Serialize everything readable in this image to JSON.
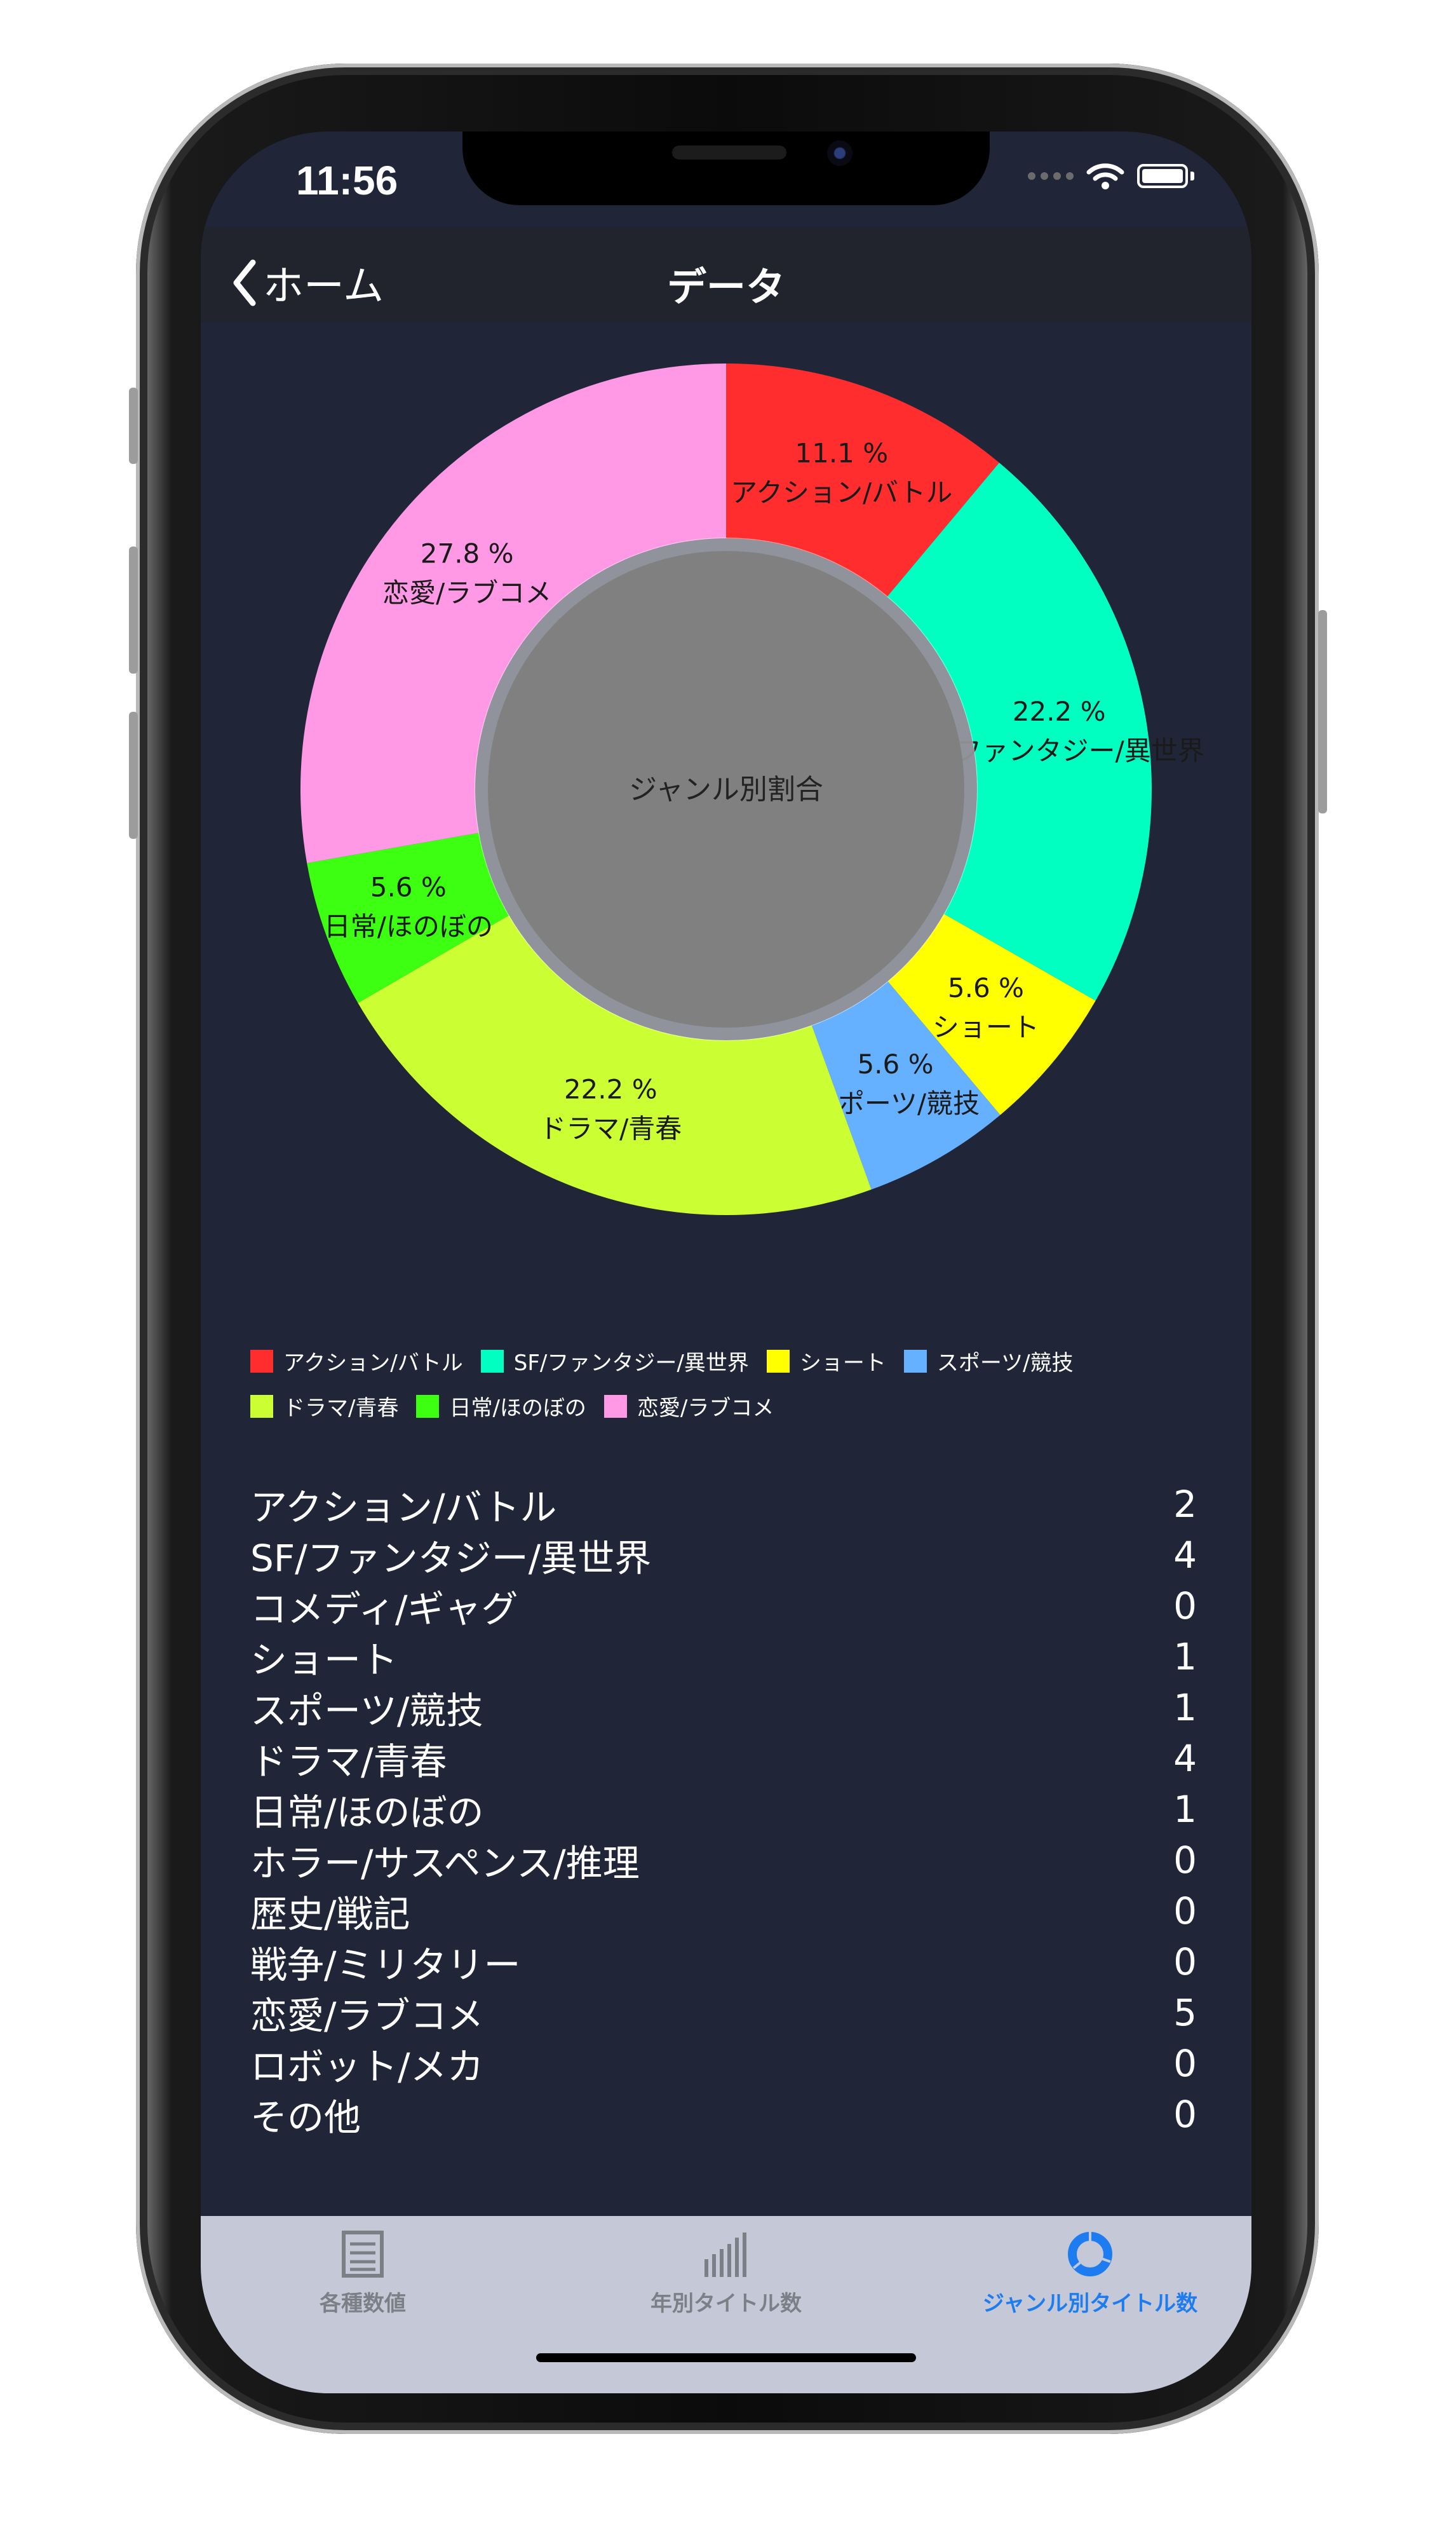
{
  "status": {
    "time": "11:56"
  },
  "nav": {
    "back_label": "ホーム",
    "title": "データ"
  },
  "chart_data": {
    "type": "pie",
    "title": "ジャンル別割合",
    "slices": [
      {
        "label": "アクション/バトル",
        "value": 11.1,
        "pct_label": "11.1 %",
        "color": "#ff2d2d"
      },
      {
        "label": "SF/ファンタジー/異世界",
        "value": 22.2,
        "pct_label": "22.2 %",
        "color": "#00ffc0"
      },
      {
        "label": "ショート",
        "value": 5.6,
        "pct_label": "5.6 %",
        "color": "#ffff00"
      },
      {
        "label": "スポーツ/競技",
        "value": 5.6,
        "pct_label": "5.6 %",
        "color": "#66b1ff"
      },
      {
        "label": "ドラマ/青春",
        "value": 22.2,
        "pct_label": "22.2 %",
        "color": "#ccff33"
      },
      {
        "label": "日常/ほのぼの",
        "value": 5.6,
        "pct_label": "5.6 %",
        "color": "#3dff12"
      },
      {
        "label": "恋愛/ラブコメ",
        "value": 27.8,
        "pct_label": "27.8 %",
        "color": "#ff99e6"
      }
    ],
    "center_color": "#808080",
    "legend_position": "bottom"
  },
  "stats": [
    {
      "label": "アクション/バトル",
      "value": "2"
    },
    {
      "label": "SF/ファンタジー/異世界",
      "value": "4"
    },
    {
      "label": "コメディ/ギャグ",
      "value": "0"
    },
    {
      "label": "ショート",
      "value": "1"
    },
    {
      "label": "スポーツ/競技",
      "value": "1"
    },
    {
      "label": "ドラマ/青春",
      "value": "4"
    },
    {
      "label": "日常/ほのぼの",
      "value": "1"
    },
    {
      "label": "ホラー/サスペンス/推理",
      "value": "0"
    },
    {
      "label": "歴史/戦記",
      "value": "0"
    },
    {
      "label": "戦争/ミリタリー",
      "value": "0"
    },
    {
      "label": "恋愛/ラブコメ",
      "value": "5"
    },
    {
      "label": "ロボット/メカ",
      "value": "0"
    },
    {
      "label": "その他",
      "value": "0"
    }
  ],
  "tabs": [
    {
      "label": "各種数値",
      "icon": "list-icon",
      "active": false
    },
    {
      "label": "年別タイトル数",
      "icon": "bar-chart-icon",
      "active": false
    },
    {
      "label": "ジャンル別タイトル数",
      "icon": "donut-chart-icon",
      "active": true
    }
  ],
  "colors": {
    "active_tab": "#1c7cf0",
    "background": "#212538"
  }
}
